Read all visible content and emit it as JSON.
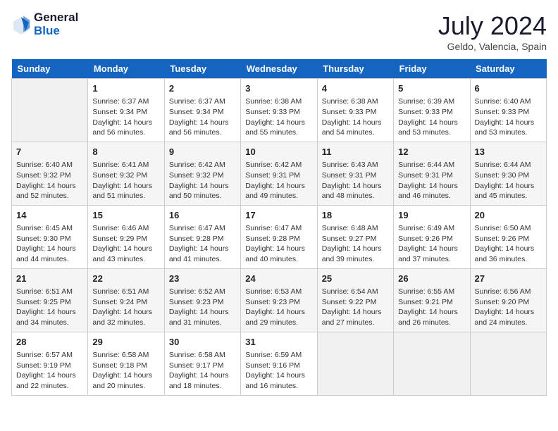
{
  "header": {
    "logo_line1": "General",
    "logo_line2": "Blue",
    "month": "July 2024",
    "location": "Geldo, Valencia, Spain"
  },
  "weekdays": [
    "Sunday",
    "Monday",
    "Tuesday",
    "Wednesday",
    "Thursday",
    "Friday",
    "Saturday"
  ],
  "weeks": [
    [
      {
        "day": null
      },
      {
        "day": "1",
        "sunrise": "6:37 AM",
        "sunset": "9:34 PM",
        "daylight": "14 hours and 56 minutes."
      },
      {
        "day": "2",
        "sunrise": "6:37 AM",
        "sunset": "9:34 PM",
        "daylight": "14 hours and 56 minutes."
      },
      {
        "day": "3",
        "sunrise": "6:38 AM",
        "sunset": "9:33 PM",
        "daylight": "14 hours and 55 minutes."
      },
      {
        "day": "4",
        "sunrise": "6:38 AM",
        "sunset": "9:33 PM",
        "daylight": "14 hours and 54 minutes."
      },
      {
        "day": "5",
        "sunrise": "6:39 AM",
        "sunset": "9:33 PM",
        "daylight": "14 hours and 53 minutes."
      },
      {
        "day": "6",
        "sunrise": "6:40 AM",
        "sunset": "9:33 PM",
        "daylight": "14 hours and 53 minutes."
      }
    ],
    [
      {
        "day": "7",
        "sunrise": "6:40 AM",
        "sunset": "9:32 PM",
        "daylight": "14 hours and 52 minutes."
      },
      {
        "day": "8",
        "sunrise": "6:41 AM",
        "sunset": "9:32 PM",
        "daylight": "14 hours and 51 minutes."
      },
      {
        "day": "9",
        "sunrise": "6:42 AM",
        "sunset": "9:32 PM",
        "daylight": "14 hours and 50 minutes."
      },
      {
        "day": "10",
        "sunrise": "6:42 AM",
        "sunset": "9:31 PM",
        "daylight": "14 hours and 49 minutes."
      },
      {
        "day": "11",
        "sunrise": "6:43 AM",
        "sunset": "9:31 PM",
        "daylight": "14 hours and 48 minutes."
      },
      {
        "day": "12",
        "sunrise": "6:44 AM",
        "sunset": "9:31 PM",
        "daylight": "14 hours and 46 minutes."
      },
      {
        "day": "13",
        "sunrise": "6:44 AM",
        "sunset": "9:30 PM",
        "daylight": "14 hours and 45 minutes."
      }
    ],
    [
      {
        "day": "14",
        "sunrise": "6:45 AM",
        "sunset": "9:30 PM",
        "daylight": "14 hours and 44 minutes."
      },
      {
        "day": "15",
        "sunrise": "6:46 AM",
        "sunset": "9:29 PM",
        "daylight": "14 hours and 43 minutes."
      },
      {
        "day": "16",
        "sunrise": "6:47 AM",
        "sunset": "9:28 PM",
        "daylight": "14 hours and 41 minutes."
      },
      {
        "day": "17",
        "sunrise": "6:47 AM",
        "sunset": "9:28 PM",
        "daylight": "14 hours and 40 minutes."
      },
      {
        "day": "18",
        "sunrise": "6:48 AM",
        "sunset": "9:27 PM",
        "daylight": "14 hours and 39 minutes."
      },
      {
        "day": "19",
        "sunrise": "6:49 AM",
        "sunset": "9:26 PM",
        "daylight": "14 hours and 37 minutes."
      },
      {
        "day": "20",
        "sunrise": "6:50 AM",
        "sunset": "9:26 PM",
        "daylight": "14 hours and 36 minutes."
      }
    ],
    [
      {
        "day": "21",
        "sunrise": "6:51 AM",
        "sunset": "9:25 PM",
        "daylight": "14 hours and 34 minutes."
      },
      {
        "day": "22",
        "sunrise": "6:51 AM",
        "sunset": "9:24 PM",
        "daylight": "14 hours and 32 minutes."
      },
      {
        "day": "23",
        "sunrise": "6:52 AM",
        "sunset": "9:23 PM",
        "daylight": "14 hours and 31 minutes."
      },
      {
        "day": "24",
        "sunrise": "6:53 AM",
        "sunset": "9:23 PM",
        "daylight": "14 hours and 29 minutes."
      },
      {
        "day": "25",
        "sunrise": "6:54 AM",
        "sunset": "9:22 PM",
        "daylight": "14 hours and 27 minutes."
      },
      {
        "day": "26",
        "sunrise": "6:55 AM",
        "sunset": "9:21 PM",
        "daylight": "14 hours and 26 minutes."
      },
      {
        "day": "27",
        "sunrise": "6:56 AM",
        "sunset": "9:20 PM",
        "daylight": "14 hours and 24 minutes."
      }
    ],
    [
      {
        "day": "28",
        "sunrise": "6:57 AM",
        "sunset": "9:19 PM",
        "daylight": "14 hours and 22 minutes."
      },
      {
        "day": "29",
        "sunrise": "6:58 AM",
        "sunset": "9:18 PM",
        "daylight": "14 hours and 20 minutes."
      },
      {
        "day": "30",
        "sunrise": "6:58 AM",
        "sunset": "9:17 PM",
        "daylight": "14 hours and 18 minutes."
      },
      {
        "day": "31",
        "sunrise": "6:59 AM",
        "sunset": "9:16 PM",
        "daylight": "14 hours and 16 minutes."
      },
      {
        "day": null
      },
      {
        "day": null
      },
      {
        "day": null
      }
    ]
  ]
}
